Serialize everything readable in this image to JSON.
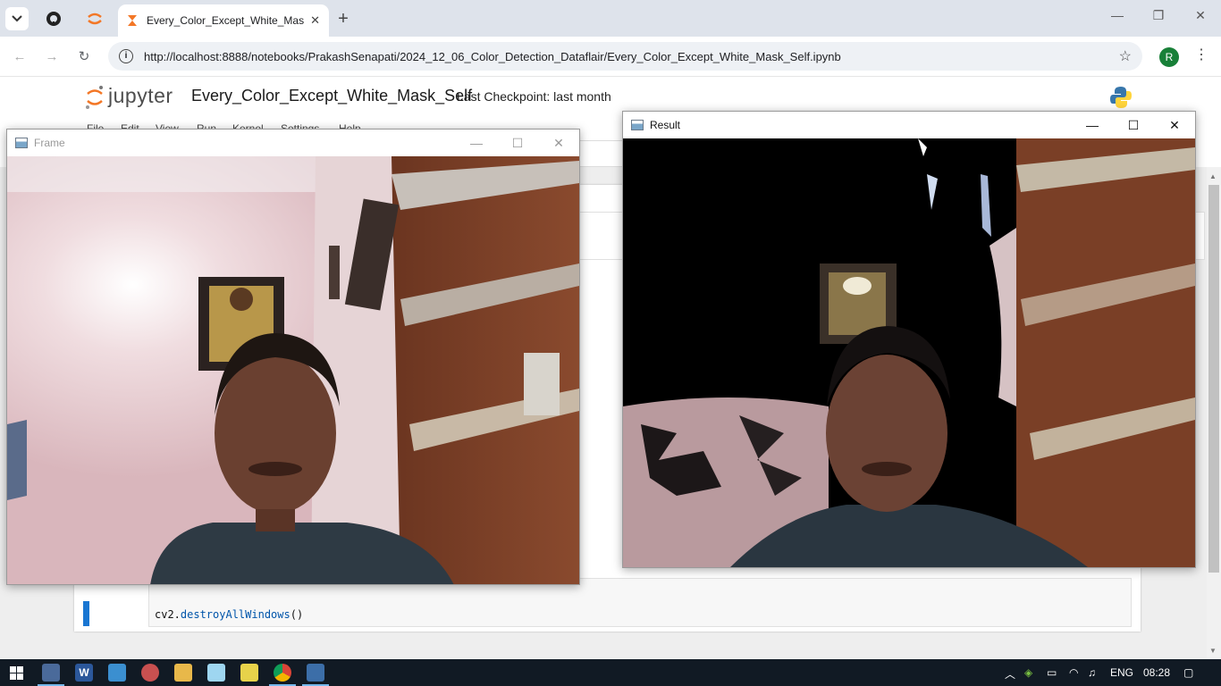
{
  "browser": {
    "tab_title": "Every_Color_Except_White_Mas",
    "url": "http://localhost:8888/notebooks/PrakashSenapati/2024_12_06_Color_Detection_Dataflair/Every_Color_Except_White_Mask_Self.ipynb",
    "profile_initial": "R"
  },
  "jupyter": {
    "logo_text": "jupyter",
    "notebook_name": "Every_Color_Except_White_Mask_Self",
    "checkpoint": "Last Checkpoint: last month",
    "menu": [
      "File",
      "Edit",
      "View",
      "Run",
      "Kernel",
      "Settings",
      "Help"
    ],
    "code_obj": "cv2.",
    "code_fn": "destroyAllWindows",
    "code_tail": "()"
  },
  "frame_window": {
    "title": "Frame"
  },
  "result_window": {
    "title": "Result"
  },
  "taskbar": {
    "language": "ENG",
    "time": "08:28",
    "accent": "#76b9ed"
  }
}
